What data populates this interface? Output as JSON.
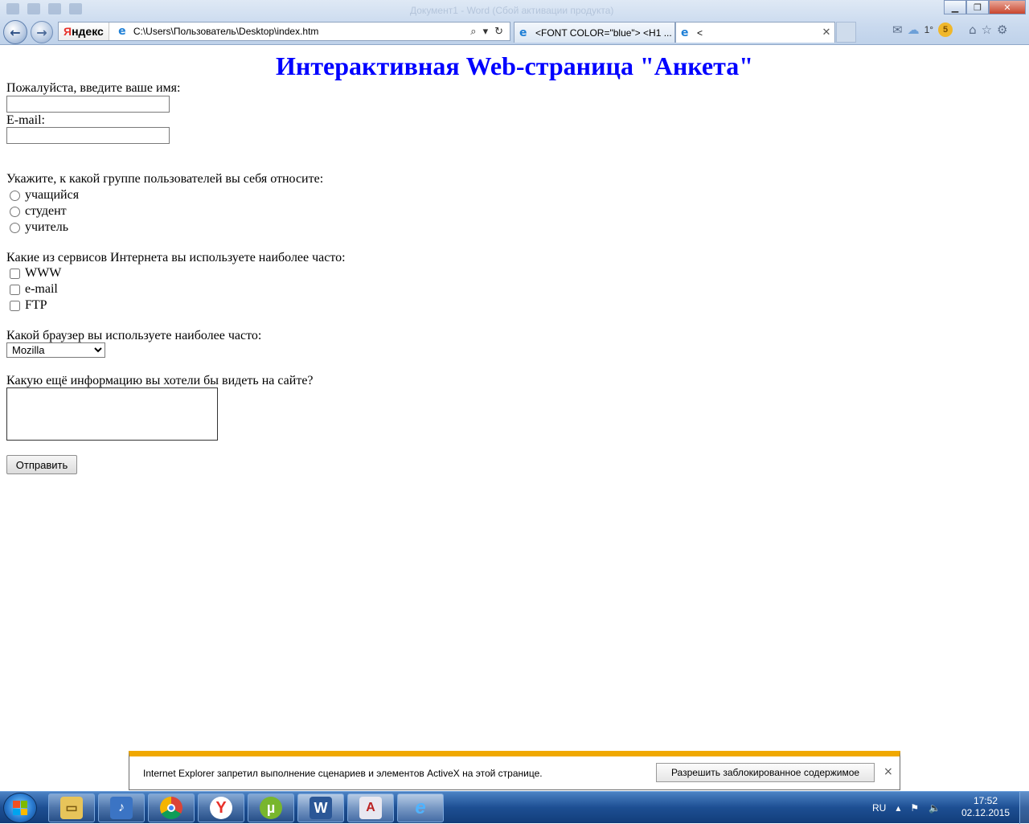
{
  "browser": {
    "window_title_ghost": "Документ1 - Word (Сбой активации продукта)",
    "address_url": "C:\\Users\\Пользователь\\Desktop\\index.htm",
    "search_logo_ya": "Я",
    "search_logo_rest": "ндекс",
    "tabs": [
      {
        "label": "<FONT COLOR=\"blue\"> <H1 ...",
        "icon": "ie-page-icon"
      },
      {
        "label": "<",
        "icon": "ie-page-icon",
        "active": true
      }
    ],
    "weather_temp": "1°",
    "coin_count": "5"
  },
  "page": {
    "title": "Интерактивная Web-страница \"Анкета\"",
    "name_label": "Пожалуйста, введите ваше имя:",
    "name_value": "",
    "email_label": "E-mail:",
    "email_value": "",
    "group_question": "Укажите, к какой группе пользователей вы себя относите:",
    "groups": [
      "учащийся",
      "студент",
      "учитель"
    ],
    "services_question": "Какие из сервисов Интернета вы используете наиболее часто:",
    "services": [
      "WWW",
      "e-mail",
      "FTP"
    ],
    "browser_question": "Какой браузер вы используете наиболее часто:",
    "browser_selected": "Mozilla",
    "info_question": "Какую ещё информацию вы хотели бы видеть на сайте?",
    "submit_label": "Отправить"
  },
  "infobar": {
    "message": "Internet Explorer запретил выполнение сценариев и элементов ActiveX на этой странице.",
    "allow_label": "Разрешить заблокированное содержимое",
    "close_glyph": "×"
  },
  "taskbar": {
    "apps": [
      "file-explorer",
      "media-player",
      "chrome",
      "yandex-browser",
      "utorrent",
      "word",
      "access-app",
      "internet-explorer"
    ],
    "lang": "RU",
    "time": "17:52",
    "date": "02.12.2015"
  },
  "colors": {
    "title_blue": "#0000ff",
    "infobar_accent": "#f0a800",
    "taskbar": "#1d4f93"
  }
}
